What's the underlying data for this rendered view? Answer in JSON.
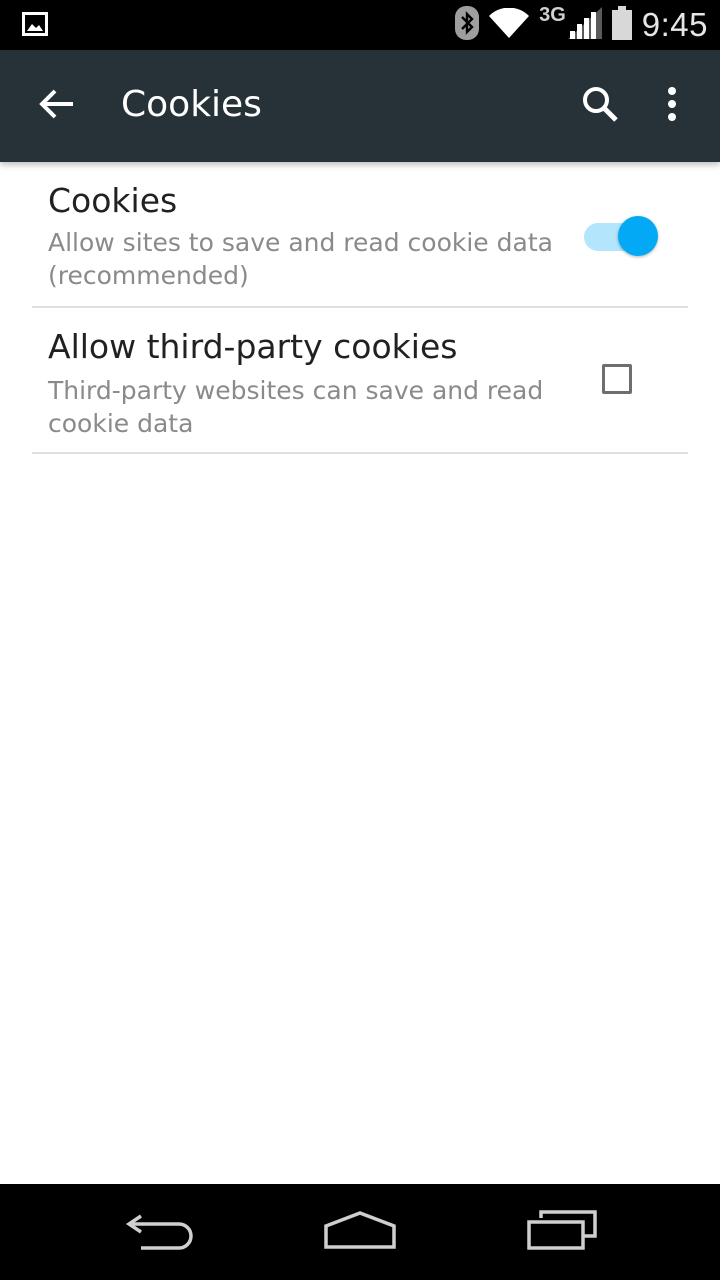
{
  "status_bar": {
    "network_type": "3G",
    "time": "9:45",
    "icons": [
      "image-notification-icon",
      "bluetooth-icon",
      "wifi-icon",
      "signal-icon",
      "battery-icon"
    ]
  },
  "toolbar": {
    "title": "Cookies",
    "back_icon": "arrow-back-icon",
    "search_icon": "search-icon",
    "overflow_icon": "more-vert-icon",
    "background_color": "#263238"
  },
  "preferences": [
    {
      "title": "Cookies",
      "summary": "Allow sites to save and read cookie data (recommended)",
      "control": "switch",
      "checked": true
    },
    {
      "title": "Allow third-party cookies",
      "summary": "Third-party websites can save and read cookie data",
      "control": "checkbox",
      "checked": false
    }
  ],
  "colors": {
    "accent": "#03a9f4",
    "accent_track": "#b3e5fc",
    "title_text": "#212121",
    "summary_text": "#8a8a8a",
    "divider": "#e0e0e0"
  },
  "nav_bar": {
    "icons": [
      "nav-back-icon",
      "nav-home-icon",
      "nav-recents-icon"
    ]
  }
}
